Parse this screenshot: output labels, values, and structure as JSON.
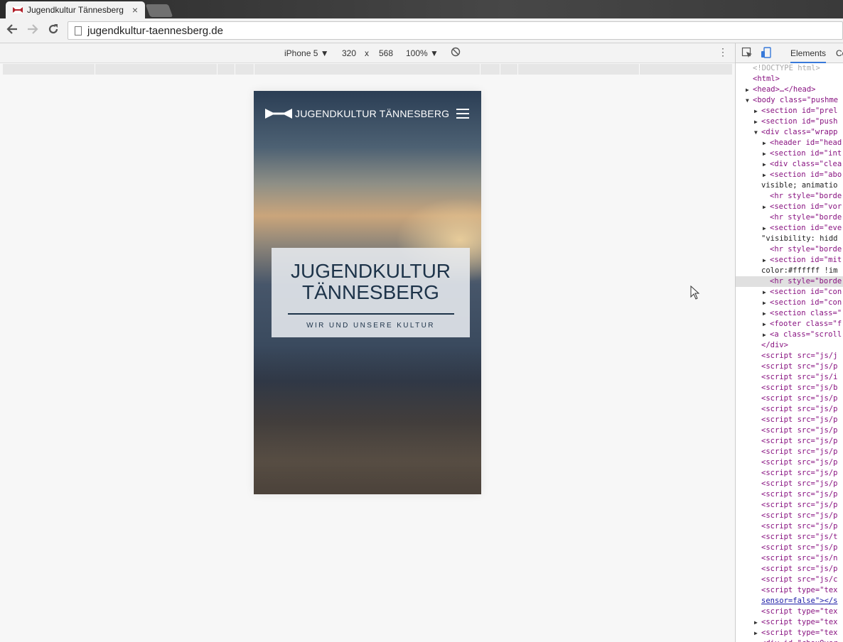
{
  "browser": {
    "tab_title": "Jugendkultur Tännesberg",
    "tab_close": "×",
    "url": "jugendkultur-taennesberg.de"
  },
  "device_toolbar": {
    "device": "iPhone 5 ▼",
    "width": "320",
    "times": "x",
    "height": "568",
    "zoom": "100% ▼",
    "menu": "⋮"
  },
  "site": {
    "brand": "JUGENDKULTUR TÄNNESBERG",
    "hero_title_line1": "JUGENDKULTUR",
    "hero_title_line2": "TÄNNESBERG",
    "hero_subtitle": "WIR UND UNSERE KULTUR"
  },
  "devtools": {
    "tab_elements": "Elements",
    "tab_console": "Co",
    "lines": [
      {
        "cls": "cmt",
        "indent": 0,
        "text": "<!DOCTYPE html>"
      },
      {
        "cls": "tag",
        "indent": 0,
        "text": "<html>"
      },
      {
        "cls": "tag",
        "indent": 0,
        "tri": "▶",
        "text": "<head>…</head>"
      },
      {
        "cls": "tag",
        "indent": 0,
        "tri": "▼",
        "text": "<body class=\"pushme"
      },
      {
        "cls": "tag",
        "indent": 1,
        "tri": "▶",
        "text": "<section id=\"prel"
      },
      {
        "cls": "tag",
        "indent": 1,
        "tri": "▶",
        "text": "<section id=\"push"
      },
      {
        "cls": "tag",
        "indent": 1,
        "tri": "▼",
        "text": "<div class=\"wrapp"
      },
      {
        "cls": "tag",
        "indent": 2,
        "tri": "▶",
        "text": "<header id=\"head"
      },
      {
        "cls": "tag",
        "indent": 2,
        "tri": "▶",
        "text": "<section id=\"int"
      },
      {
        "cls": "tag",
        "indent": 2,
        "tri": "▶",
        "text": "<div class=\"clea"
      },
      {
        "cls": "tag",
        "indent": 2,
        "tri": "▶",
        "text": "<section id=\"abo"
      },
      {
        "cls": "txt",
        "indent": 1,
        "text": "visible; animatio"
      },
      {
        "cls": "tag",
        "indent": 2,
        "text": "<hr style=\"borde"
      },
      {
        "cls": "tag",
        "indent": 2,
        "tri": "▶",
        "text": "<section id=\"vor"
      },
      {
        "cls": "tag",
        "indent": 2,
        "text": "<hr style=\"borde"
      },
      {
        "cls": "tag",
        "indent": 2,
        "tri": "▶",
        "text": "<section id=\"eve"
      },
      {
        "cls": "txt",
        "indent": 1,
        "text": "\"visibility: hidd"
      },
      {
        "cls": "tag",
        "indent": 2,
        "text": "<hr style=\"borde"
      },
      {
        "cls": "tag",
        "indent": 2,
        "tri": "▶",
        "text": "<section id=\"mit"
      },
      {
        "cls": "txt",
        "indent": 1,
        "text": "color:#ffffff !im"
      },
      {
        "cls": "tag",
        "indent": 2,
        "text": "<hr style=\"borde",
        "sel": true
      },
      {
        "cls": "tag",
        "indent": 2,
        "tri": "▶",
        "text": "<section id=\"con"
      },
      {
        "cls": "tag",
        "indent": 2,
        "tri": "▶",
        "text": "<section id=\"con"
      },
      {
        "cls": "tag",
        "indent": 2,
        "tri": "▶",
        "text": "<section class=\""
      },
      {
        "cls": "tag",
        "indent": 2,
        "tri": "▶",
        "text": "<footer class=\"f"
      },
      {
        "cls": "tag",
        "indent": 2,
        "tri": "▶",
        "text": "<a class=\"scroll"
      },
      {
        "cls": "tag",
        "indent": 1,
        "text": "</div>"
      },
      {
        "cls": "tag",
        "indent": 1,
        "text": "<script src=\"js/j"
      },
      {
        "cls": "tag",
        "indent": 1,
        "text": "<script src=\"js/p"
      },
      {
        "cls": "tag",
        "indent": 1,
        "text": "<script src=\"js/i"
      },
      {
        "cls": "tag",
        "indent": 1,
        "text": "<script src=\"js/b"
      },
      {
        "cls": "tag",
        "indent": 1,
        "text": "<script src=\"js/p"
      },
      {
        "cls": "tag",
        "indent": 1,
        "text": "<script src=\"js/p"
      },
      {
        "cls": "tag",
        "indent": 1,
        "text": "<script src=\"js/p"
      },
      {
        "cls": "tag",
        "indent": 1,
        "text": "<script src=\"js/p"
      },
      {
        "cls": "tag",
        "indent": 1,
        "text": "<script src=\"js/p"
      },
      {
        "cls": "tag",
        "indent": 1,
        "text": "<script src=\"js/p"
      },
      {
        "cls": "tag",
        "indent": 1,
        "text": "<script src=\"js/p"
      },
      {
        "cls": "tag",
        "indent": 1,
        "text": "<script src=\"js/p"
      },
      {
        "cls": "tag",
        "indent": 1,
        "text": "<script src=\"js/p"
      },
      {
        "cls": "tag",
        "indent": 1,
        "text": "<script src=\"js/p"
      },
      {
        "cls": "tag",
        "indent": 1,
        "text": "<script src=\"js/p"
      },
      {
        "cls": "tag",
        "indent": 1,
        "text": "<script src=\"js/p"
      },
      {
        "cls": "tag",
        "indent": 1,
        "text": "<script src=\"js/p"
      },
      {
        "cls": "tag",
        "indent": 1,
        "text": "<script src=\"js/t"
      },
      {
        "cls": "tag",
        "indent": 1,
        "text": "<script src=\"js/p"
      },
      {
        "cls": "tag",
        "indent": 1,
        "text": "<script src=\"js/n"
      },
      {
        "cls": "tag",
        "indent": 1,
        "text": "<script src=\"js/p"
      },
      {
        "cls": "tag",
        "indent": 1,
        "text": "<script src=\"js/c"
      },
      {
        "cls": "tag",
        "indent": 1,
        "text": "<script type=\"tex"
      },
      {
        "cls": "link",
        "indent": 1,
        "text": "sensor=false\"></s"
      },
      {
        "cls": "tag",
        "indent": 1,
        "text": "<script type=\"tex"
      },
      {
        "cls": "tag",
        "indent": 1,
        "tri": "▶",
        "text": "<script type=\"tex"
      },
      {
        "cls": "tag",
        "indent": 1,
        "tri": "▶",
        "text": "<script type=\"tex"
      },
      {
        "cls": "tag",
        "indent": 1,
        "text": "<div id=\"cboxOver"
      }
    ]
  },
  "colors": {
    "accent_tab": "#3879d9",
    "hero_text": "#1d3349",
    "favicon": "#b3202a"
  }
}
